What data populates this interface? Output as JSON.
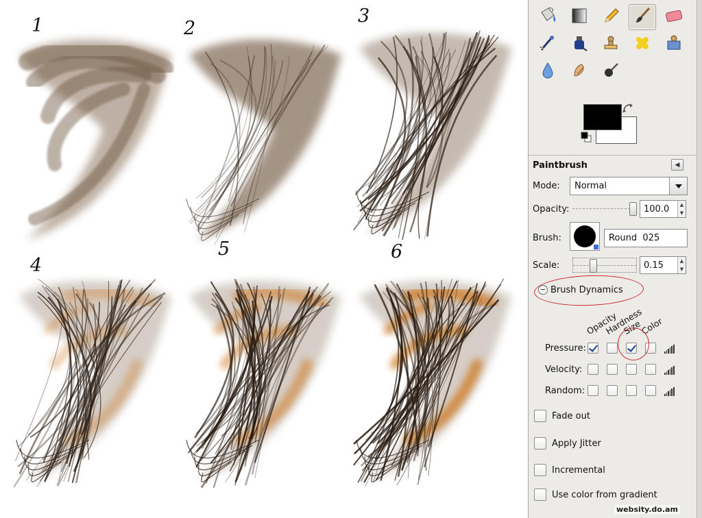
{
  "canvas": {
    "steps": [
      {
        "number": "1"
      },
      {
        "number": "2"
      },
      {
        "number": "3"
      },
      {
        "number": "4"
      },
      {
        "number": "5"
      },
      {
        "number": "6"
      }
    ]
  },
  "toolbox": {
    "tools": [
      {
        "icon": "bucket-fill-icon"
      },
      {
        "icon": "blend-gradient-icon"
      },
      {
        "icon": "pencil-icon"
      },
      {
        "icon": "paintbrush-icon",
        "active": true
      },
      {
        "icon": "eraser-icon"
      },
      {
        "icon": "airbrush-icon"
      },
      {
        "icon": "ink-icon"
      },
      {
        "icon": "clone-stamp-icon"
      },
      {
        "icon": "heal-icon"
      },
      {
        "icon": "perspective-clone-icon"
      },
      {
        "icon": "blur-sharpen-icon"
      },
      {
        "icon": "smudge-icon"
      },
      {
        "icon": "dodge-burn-icon"
      }
    ],
    "colors": {
      "foreground": "#000000",
      "background": "#ffffff"
    }
  },
  "options": {
    "title": "Paintbrush",
    "mode": {
      "label": "Mode:",
      "value": "Normal"
    },
    "opacity": {
      "label": "Opacity:",
      "value": "100.0",
      "level": 1.0
    },
    "brush": {
      "label": "Brush:",
      "value": "Round  025"
    },
    "scale": {
      "label": "Scale:",
      "value": "0.15",
      "level": 0.3
    },
    "brush_dynamics": {
      "label": "Brush Dynamics",
      "columns": [
        "Opacity",
        "Hardness",
        "Size",
        "Color"
      ],
      "rows": [
        {
          "label": "Pressure:",
          "checked": [
            true,
            false,
            true,
            false
          ]
        },
        {
          "label": "Velocity:",
          "checked": [
            false,
            false,
            false,
            false
          ]
        },
        {
          "label": "Random:",
          "checked": [
            false,
            false,
            false,
            false
          ]
        }
      ]
    },
    "checkboxes": [
      {
        "label": "Fade out",
        "checked": false
      },
      {
        "label": "Apply Jitter",
        "checked": false
      },
      {
        "label": "Incremental",
        "checked": false
      },
      {
        "label": "Use color from gradient",
        "checked": false
      }
    ]
  },
  "watermark": "websity.do.am",
  "colors": {
    "annotation_red": "#d0282a",
    "hair_dark": "#2a1c12",
    "hair_mid": "#5a3d24",
    "hair_highlight": "#d07a22"
  }
}
